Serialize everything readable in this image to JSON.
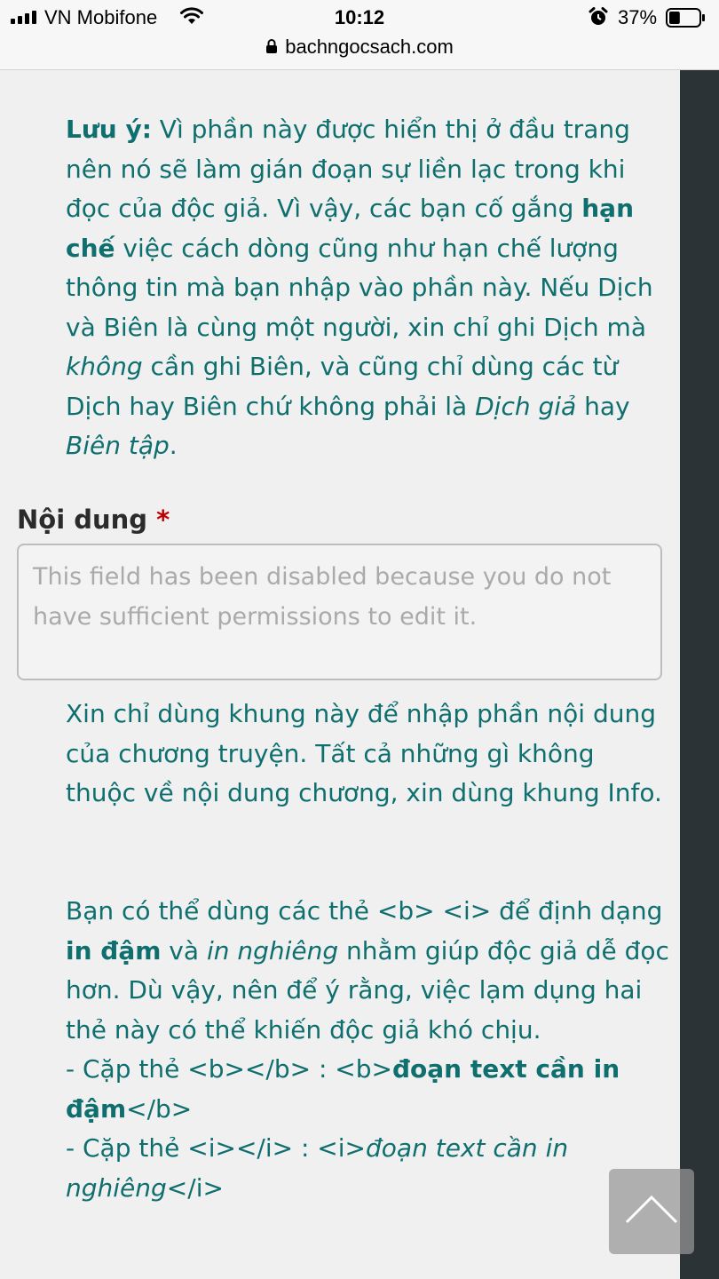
{
  "status_bar": {
    "carrier": "VN Mobifone",
    "time": "10:12",
    "battery": "37%",
    "battery_level": 0.37
  },
  "url_bar": {
    "domain": "bachngocsach.com"
  },
  "note_intro": {
    "label": "Lưu ý:",
    "t1": " Vì phần này được hiển thị ở đầu trang nên nó sẽ làm gián đoạn sự liền lạc trong khi đọc của độc giả. Vì vậy, các bạn cố gắng ",
    "bold": "hạn chế",
    "t2": " việc cách dòng cũng như hạn chế lượng thông tin mà bạn nhập vào phần này. Nếu Dịch và Biên là cùng một người, xin chỉ ghi Dịch mà ",
    "ital1": "không",
    "t3": " cần ghi Biên, và cũng chỉ dùng các từ Dịch hay Biên chứ không phải là ",
    "ital2": "Dịch giả",
    "t4": " hay ",
    "ital3": "Biên tập",
    "t5": "."
  },
  "content_field": {
    "label": "Nội dung",
    "required_mark": "*",
    "placeholder": "This field has been disabled because you do not have sufficient permissions to edit it.",
    "value": ""
  },
  "help_text": {
    "p1": "Xin chỉ dùng khung này để nhập phần nội dung của chương truyện. Tất cả những gì không thuộc về nội dung chương, xin dùng khung Info.",
    "p2a": "Bạn có thể dùng các thẻ <b> <i> để định dạng ",
    "p2b": "in đậm",
    "p2c": " và ",
    "p2d": "in nghiêng",
    "p2e": " nhằm giúp độc giả dễ đọc hơn. Dù vậy, nên để ý rằng, việc lạm dụng hai thẻ này có thể khiến độc giả khó chịu.",
    "l1a": "- Cặp thẻ <b></b> : <b>",
    "l1b": "đoạn text cần in đậm",
    "l1c": "</b>",
    "l2a": "- Cặp thẻ <i></i> : <i>",
    "l2b": "đoạn text cần in nghiêng",
    "l2c": "</i>"
  },
  "icons": {
    "signal": "signal-bars-icon",
    "wifi": "wifi-icon",
    "alarm": "alarm-clock-icon",
    "battery": "battery-icon",
    "lock": "lock-icon",
    "scroll_top": "chevron-up-icon"
  },
  "colors": {
    "help_text": "#0f6f6f",
    "label": "#2b2b2b",
    "required": "#c00000",
    "sidebar": "#2c3337"
  }
}
